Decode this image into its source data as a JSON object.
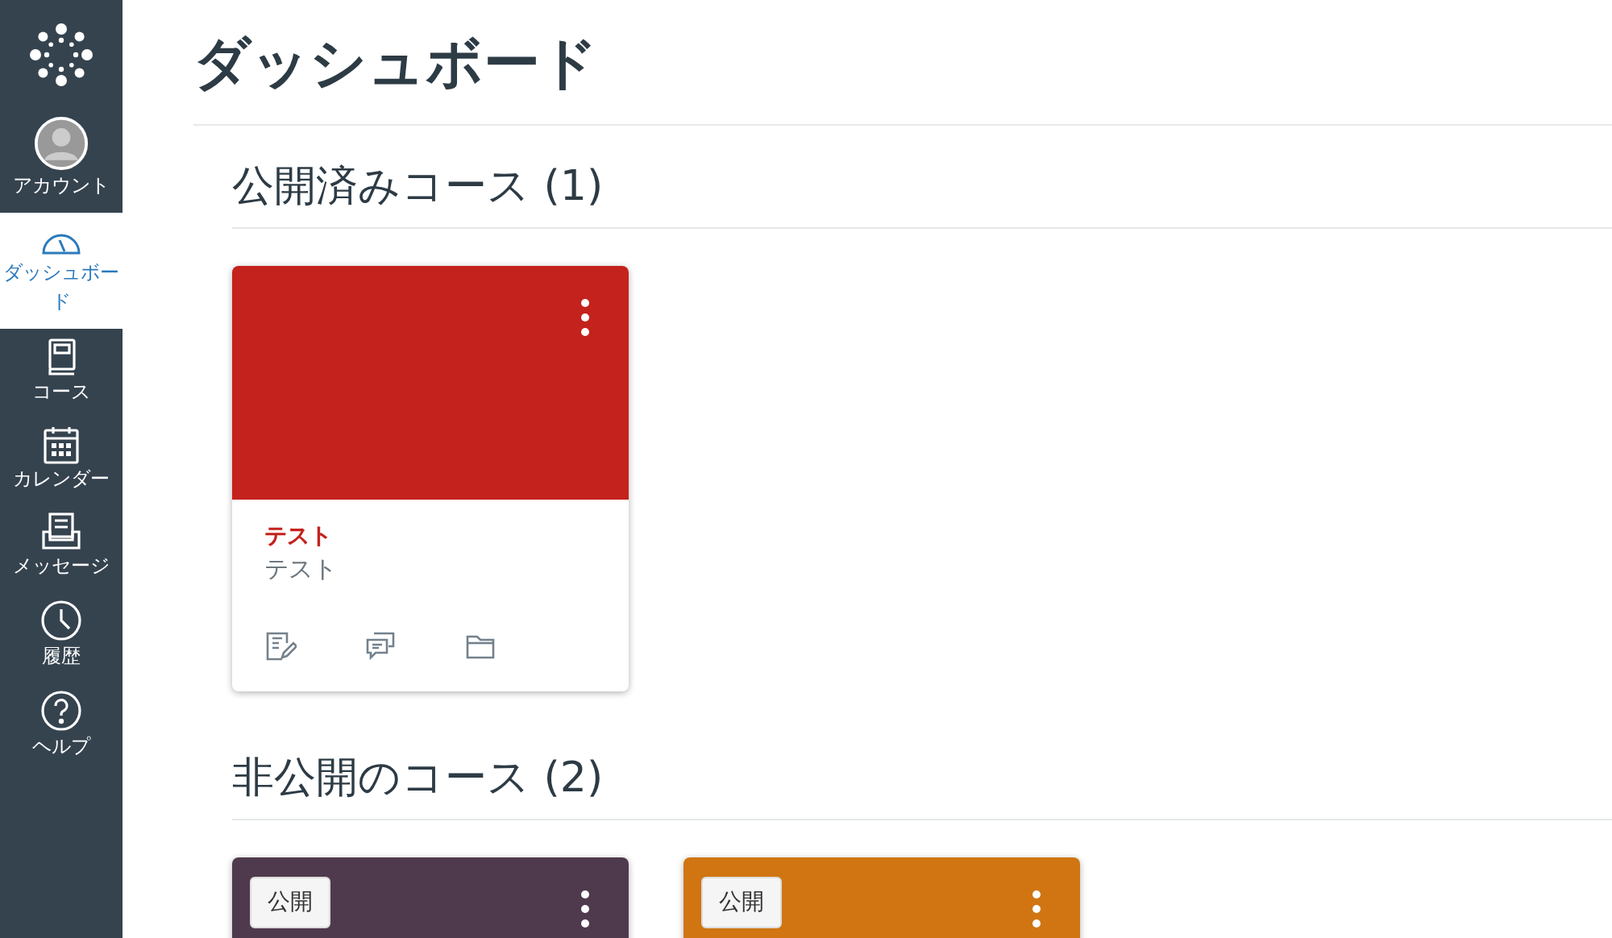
{
  "nav": [
    {
      "kind": "account",
      "label": "アカウント",
      "selected": false
    },
    {
      "kind": "dashboard",
      "label": "ダッシュボード",
      "selected": true
    },
    {
      "kind": "courses",
      "label": "コース",
      "selected": false
    },
    {
      "kind": "calendar",
      "label": "カレンダー",
      "selected": false
    },
    {
      "kind": "inbox",
      "label": "メッセージ",
      "selected": false
    },
    {
      "kind": "history",
      "label": "履歴",
      "selected": false
    },
    {
      "kind": "help",
      "label": "ヘルプ",
      "selected": false
    }
  ],
  "title": "ダッシュボード",
  "sections": [
    {
      "heading": "公開済みコース (1)",
      "cards": [
        {
          "color": "#c4221c",
          "title": "テスト",
          "subtitle": "テスト"
        }
      ]
    },
    {
      "heading": "非公開のコース (2)",
      "cards": [
        {
          "color": "#4f3a4d",
          "publish_button": "公開"
        },
        {
          "color": "#d07512",
          "publish_button": "公開"
        }
      ]
    }
  ]
}
